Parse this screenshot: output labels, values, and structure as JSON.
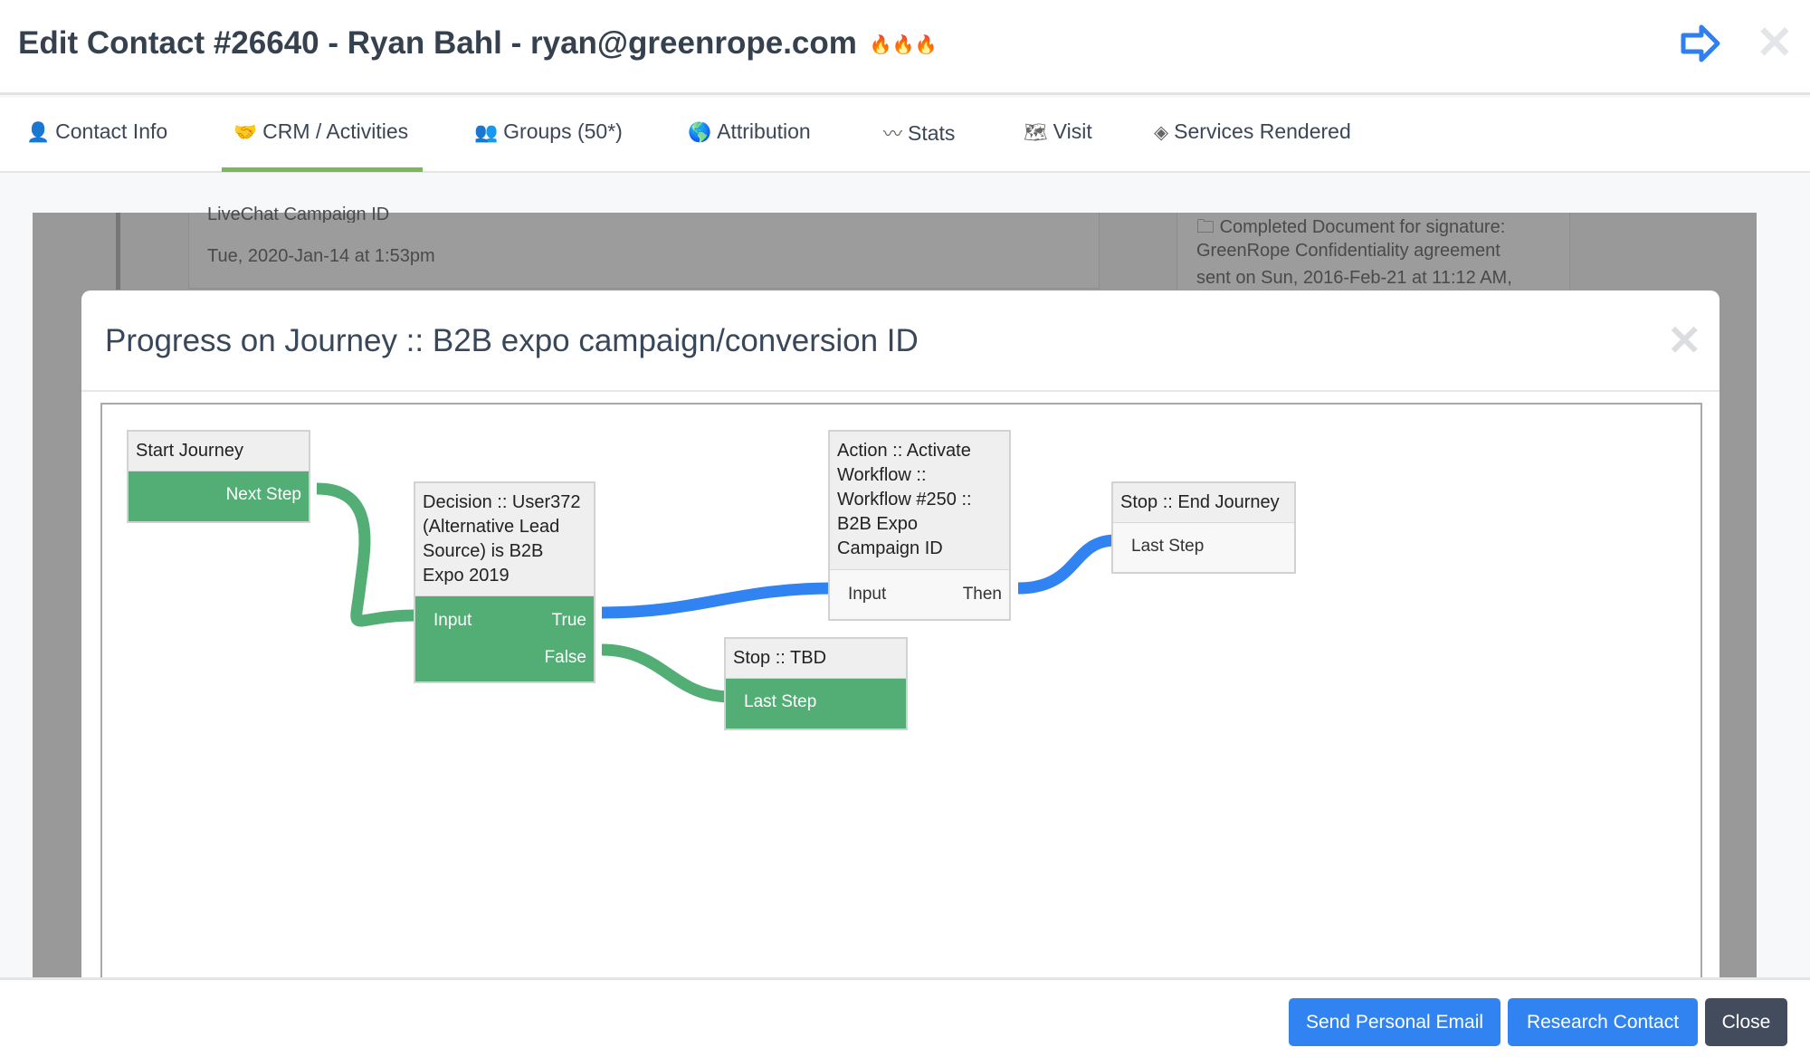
{
  "header": {
    "title": "Edit Contact #26640 - Ryan Bahl - ryan@greenrope.com",
    "badge": "🔥🔥🔥",
    "next_icon": "arrow-right-icon",
    "close_icon": "close-icon"
  },
  "tabs": [
    {
      "label": "Contact Info",
      "icon": "👤"
    },
    {
      "label": "CRM / Activities",
      "icon": "🤝",
      "active": true
    },
    {
      "label": "Groups (50*)",
      "icon": "👥"
    },
    {
      "label": "Attribution",
      "icon": "🌎"
    },
    {
      "label": "Stats",
      "icon": "〰"
    },
    {
      "label": "Visit",
      "icon": "🗺"
    },
    {
      "label": "Services Rendered",
      "icon": "◈"
    }
  ],
  "background": {
    "activity_title": "LiveChat Campaign ID",
    "activity_date": "Tue, 2020-Jan-14 at 1:53pm",
    "doc_lines": [
      "Completed Document for signature:",
      "GreenRope Confidentiality agreement",
      "sent on Sun, 2016-Feb-21 at 11:12 AM,"
    ]
  },
  "modal": {
    "title": "Progress on Journey :: B2B expo campaign/conversion ID",
    "nodes": {
      "start": {
        "title": "Start Journey",
        "out": "Next Step"
      },
      "decision": {
        "title": "Decision :: User372 (Alternative Lead Source) is B2B Expo 2019",
        "in": "Input",
        "true": "True",
        "false": "False"
      },
      "action": {
        "title": "Action :: Activate Workflow :: Workflow #250 :: B2B Expo Campaign ID",
        "in": "Input",
        "out": "Then"
      },
      "stop_tbd": {
        "title": "Stop :: TBD",
        "in": "Last Step"
      },
      "stop_end": {
        "title": "Stop :: End Journey",
        "in": "Last Step"
      }
    },
    "colors": {
      "completed": "#52ae74",
      "active_path": "#3283f2"
    }
  },
  "footer": {
    "send_email": "Send Personal Email",
    "research": "Research Contact",
    "close": "Close"
  }
}
